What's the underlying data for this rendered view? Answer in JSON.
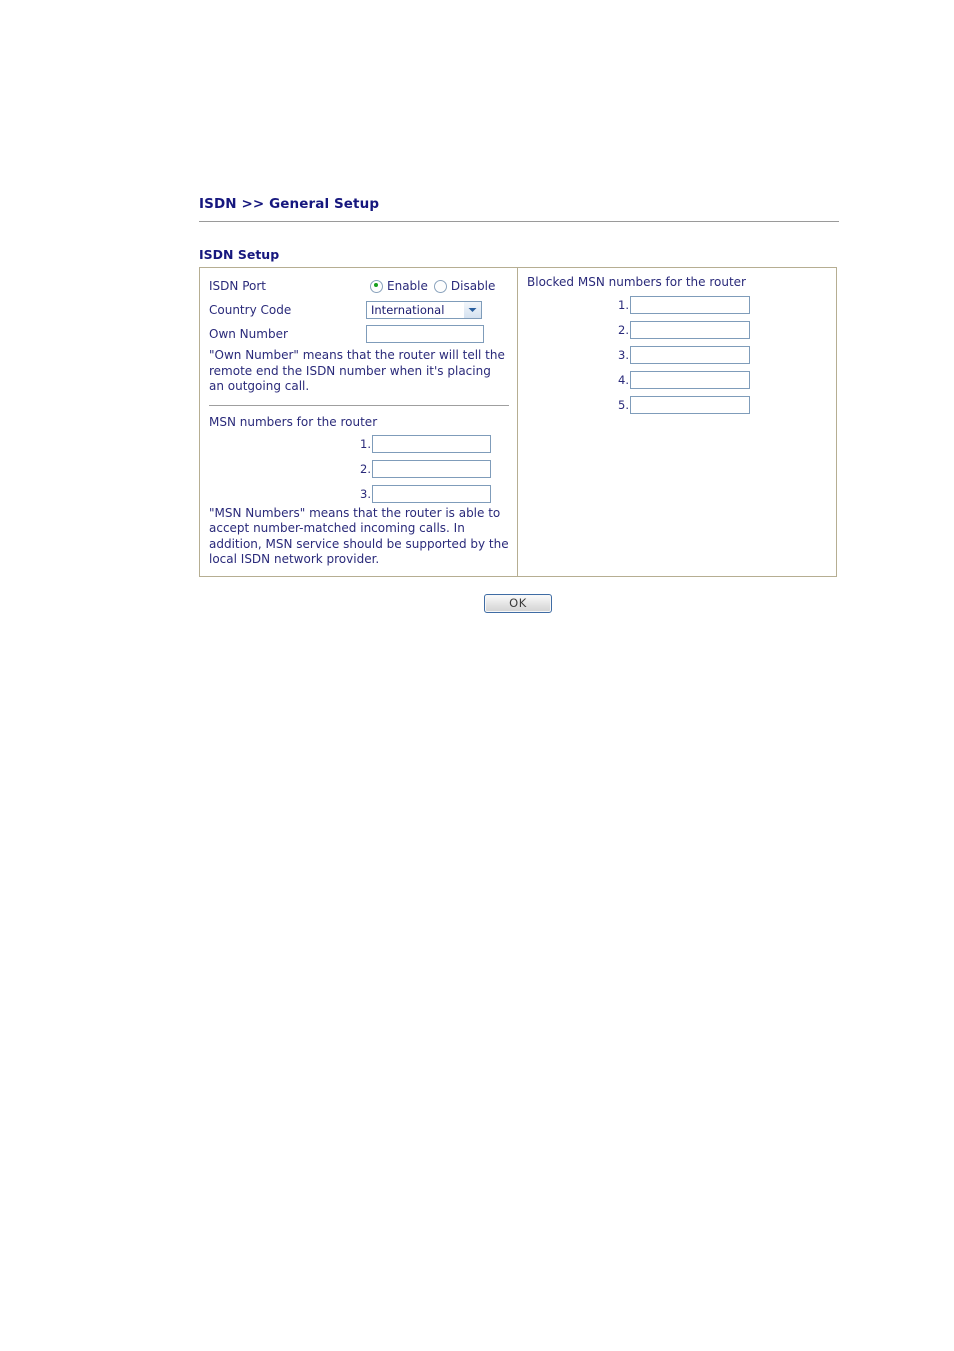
{
  "breadcrumb": {
    "text": "ISDN >> General Setup"
  },
  "section": {
    "heading": "ISDN Setup"
  },
  "left_panel": {
    "isdn_port": {
      "label": "ISDN Port",
      "options": [
        {
          "label": "Enable",
          "selected": true
        },
        {
          "label": "Disable",
          "selected": false
        }
      ]
    },
    "country_code": {
      "label": "Country Code",
      "value": "International",
      "options": [
        "International"
      ]
    },
    "own_number": {
      "label": "Own Number",
      "value": "",
      "placeholder": ""
    },
    "own_number_note": "\"Own Number\" means that the router will tell the remote end the ISDN number when it's placing an outgoing call.",
    "msn_numbers": {
      "title": "MSN numbers for the router",
      "rows": [
        {
          "num": "1.",
          "value": ""
        },
        {
          "num": "2.",
          "value": ""
        },
        {
          "num": "3.",
          "value": ""
        }
      ]
    },
    "msn_note": "\"MSN Numbers\" means that the router is able to accept number-matched incoming calls. In addition, MSN service should be supported by the local ISDN network provider."
  },
  "right_panel": {
    "blocked_msn": {
      "title": "Blocked MSN numbers for the router",
      "rows": [
        {
          "num": "1.",
          "value": ""
        },
        {
          "num": "2.",
          "value": ""
        },
        {
          "num": "3.",
          "value": ""
        },
        {
          "num": "4.",
          "value": ""
        },
        {
          "num": "5.",
          "value": ""
        }
      ]
    }
  },
  "actions": {
    "ok_label": "OK"
  },
  "colors": {
    "title_navy": "#16177e",
    "text_navy": "#2a2a7a",
    "panel_border": "#b6ae92",
    "input_border": "#7f9cba",
    "radio_selected": "#18a01c",
    "button_border": "#3f6ca4"
  }
}
